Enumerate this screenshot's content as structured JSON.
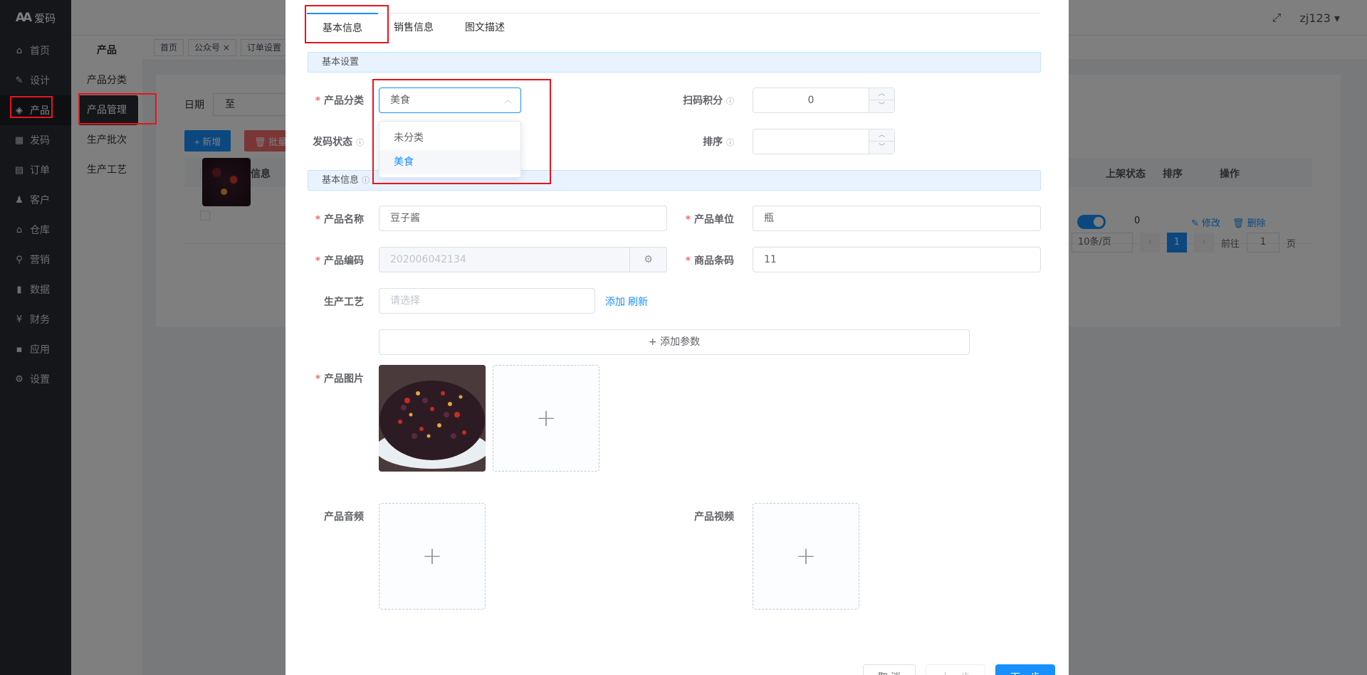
{
  "app": {
    "logo_mark": "AA",
    "logo_text": "爱码"
  },
  "sidebar": {
    "items": [
      {
        "label": "首页",
        "icon": "home-icon",
        "glyph": "⌂"
      },
      {
        "label": "设计",
        "icon": "design-icon",
        "glyph": "✎"
      },
      {
        "label": "产品",
        "icon": "cube-icon",
        "glyph": "◈"
      },
      {
        "label": "发码",
        "icon": "grid-icon",
        "glyph": "▦"
      },
      {
        "label": "订单",
        "icon": "order-icon",
        "glyph": "▤"
      },
      {
        "label": "客户",
        "icon": "users-icon",
        "glyph": "♟"
      },
      {
        "label": "仓库",
        "icon": "warehouse-icon",
        "glyph": "⌂"
      },
      {
        "label": "营销",
        "icon": "share-icon",
        "glyph": "⚲"
      },
      {
        "label": "数据",
        "icon": "chart-icon",
        "glyph": "▮"
      },
      {
        "label": "财务",
        "icon": "yen-icon",
        "glyph": "¥"
      },
      {
        "label": "应用",
        "icon": "apps-icon",
        "glyph": "▪"
      },
      {
        "label": "设置",
        "icon": "gear-icon",
        "glyph": "⚙"
      }
    ]
  },
  "subnav": {
    "title": "产品",
    "items": [
      {
        "label": "产品分类"
      },
      {
        "label": "产品管理"
      },
      {
        "label": "生产批次"
      },
      {
        "label": "生产工艺"
      }
    ]
  },
  "topbar": {
    "user": "zj123",
    "expand_glyph": "⤢",
    "caret": "▾"
  },
  "tags": [
    {
      "label": "首页"
    },
    {
      "label": "公众号  ×"
    },
    {
      "label": "订单设置"
    }
  ],
  "list": {
    "filter_label": "日期",
    "filter_to": "至",
    "add_label": "+ 新增",
    "batch_label": "🗑 批量删除",
    "columns": {
      "info": "产品信息",
      "status": "上架状态",
      "sort": "排序",
      "ops": "操作"
    },
    "row": {
      "sort": "0",
      "edit": "✎ 修改",
      "delete": "🗑 删除"
    },
    "pager": {
      "size": "10条/页",
      "current": "1",
      "goto_prefix": "前往",
      "goto_value": "1",
      "goto_suffix": "页",
      "prev": "‹",
      "next": "›"
    }
  },
  "dialog": {
    "tabs": [
      {
        "label": "基本信息"
      },
      {
        "label": "销售信息"
      },
      {
        "label": "图文描述"
      }
    ],
    "section_basic_settings": "基本设置",
    "section_basic_info": "基本信息",
    "info_glyph": "ⓘ",
    "fields": {
      "category": {
        "label": "产品分类",
        "value": "美食",
        "chevron": "︿"
      },
      "scan_points": {
        "label": "扫码积分",
        "value": "0"
      },
      "code_status": {
        "label": "发码状态"
      },
      "sort": {
        "label": "排序",
        "value": ""
      },
      "name": {
        "label": "产品名称",
        "value": "豆子酱"
      },
      "unit": {
        "label": "产品单位",
        "value": "瓶"
      },
      "code": {
        "label": "产品编码",
        "value": "202006042134",
        "gen_glyph": "⚙"
      },
      "barcode": {
        "label": "商品条码",
        "value": "11"
      },
      "craft": {
        "label": "生产工艺",
        "placeholder": "请选择",
        "add": "添加",
        "refresh": "刷新"
      },
      "add_param": "+ 添加参数",
      "image": {
        "label": "产品图片"
      },
      "audio": {
        "label": "产品音频"
      },
      "video": {
        "label": "产品视频"
      }
    },
    "dropdown": [
      {
        "label": "未分类"
      },
      {
        "label": "美食",
        "selected": true
      }
    ],
    "upload_glyph": "+",
    "arrow_up": "︿",
    "arrow_down": "﹀",
    "footer": {
      "cancel": "取 消",
      "prev": "上一步",
      "next": "下一步"
    }
  },
  "colors": {
    "accent": "#1890ff",
    "highlight": "#e8141c",
    "sidebar": "#2a2d35"
  }
}
